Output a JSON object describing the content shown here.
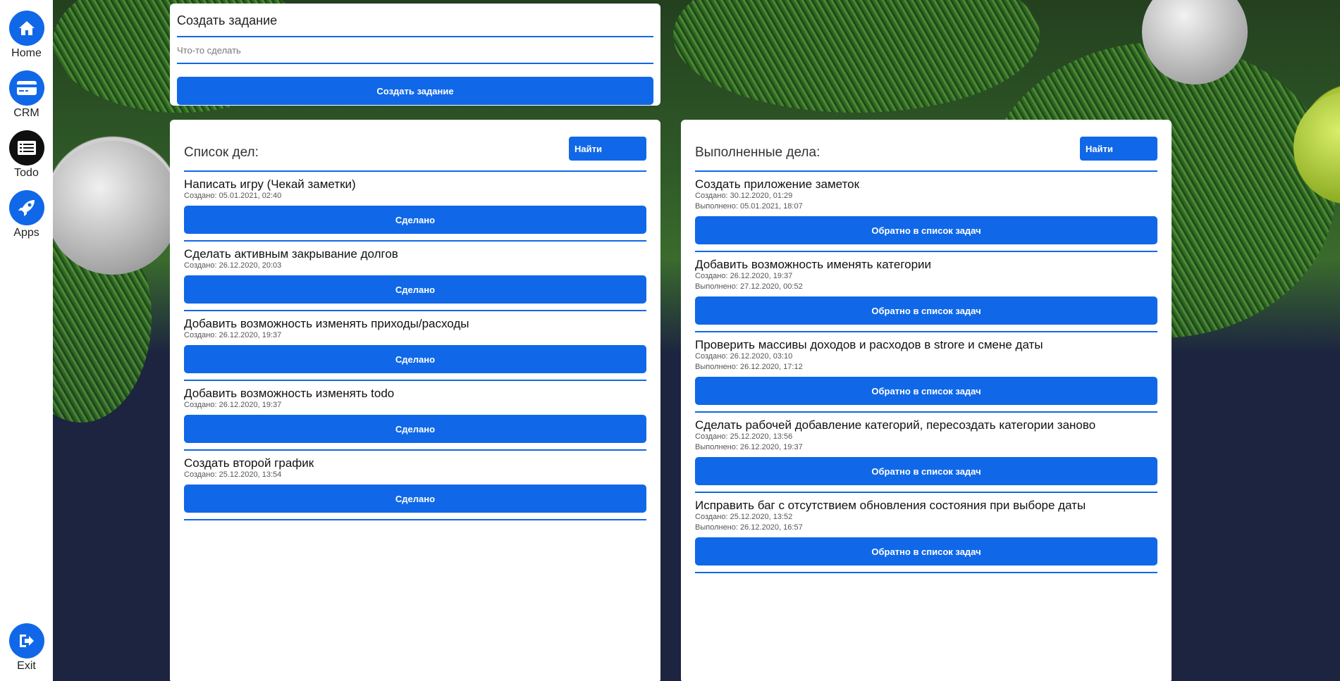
{
  "sidebar": {
    "items": [
      {
        "label": "Home",
        "icon": "home-icon"
      },
      {
        "label": "CRM",
        "icon": "credit-card-icon"
      },
      {
        "label": "Todo",
        "icon": "list-icon"
      },
      {
        "label": "Apps",
        "icon": "rocket-icon"
      }
    ],
    "exit": {
      "label": "Exit",
      "icon": "exit-icon"
    }
  },
  "create": {
    "title": "Создать задание",
    "placeholder": "Что-то сделать",
    "button": "Создать задание"
  },
  "todo": {
    "title": "Список дел:",
    "find": "Найти",
    "button_label": "Сделано",
    "items": [
      {
        "title": "Написать игру (Чекай заметки)",
        "created": "Создано: 05.01.2021, 02:40"
      },
      {
        "title": "Сделать активным закрывание долгов",
        "created": "Создано: 26.12.2020, 20:03"
      },
      {
        "title": "Добавить возможность изменять приходы/расходы",
        "created": "Создано: 26.12.2020, 19:37"
      },
      {
        "title": "Добавить возможность изменять todo",
        "created": "Создано: 26.12.2020, 19:37"
      },
      {
        "title": "Создать второй график",
        "created": "Создано: 25.12.2020, 13:54"
      }
    ]
  },
  "done": {
    "title": "Выполненные дела:",
    "find": "Найти",
    "button_label": "Обратно в список задач",
    "items": [
      {
        "title": "Создать приложение заметок",
        "created": "Создано: 30.12.2020, 01:29",
        "completed": "Выполнено: 05.01.2021, 18:07"
      },
      {
        "title": "Добавить возможность именять категории",
        "created": "Создано: 26.12.2020, 19:37",
        "completed": "Выполнено: 27.12.2020, 00:52"
      },
      {
        "title": "Проверить массивы доходов и расходов в strore и смене даты",
        "created": "Создано: 26.12.2020, 03:10",
        "completed": "Выполнено: 26.12.2020, 17:12"
      },
      {
        "title": "Сделать рабочей добавление категорий, пересоздать категории заново",
        "created": "Создано: 25.12.2020, 13:56",
        "completed": "Выполнено: 26.12.2020, 19:37"
      },
      {
        "title": "Исправить баг с отсутствием обновления состояния при выборе даты",
        "created": "Создано: 25.12.2020, 13:52",
        "completed": "Выполнено: 26.12.2020, 16:57"
      }
    ]
  },
  "colors": {
    "accent": "#1068e8",
    "sidebar_bg": "#ffffff",
    "page_bg": "#1c2440"
  }
}
